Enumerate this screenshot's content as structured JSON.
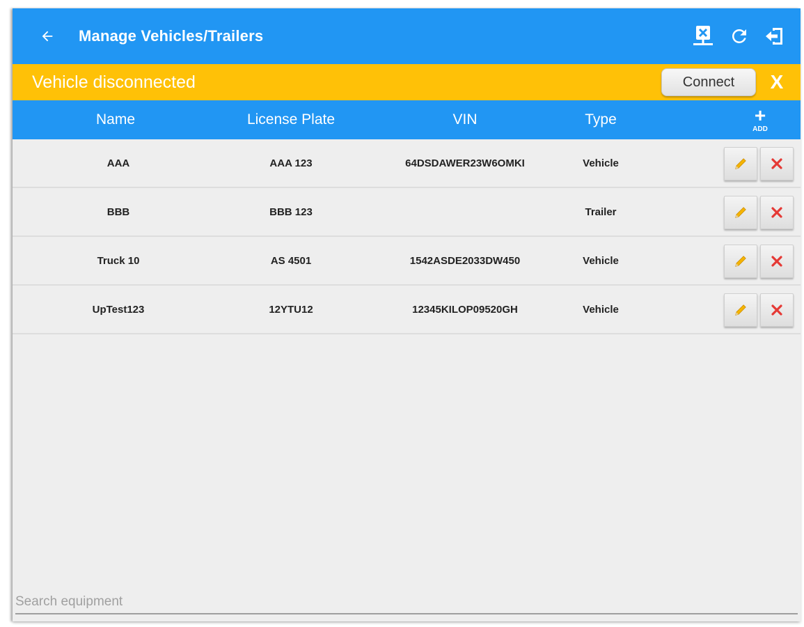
{
  "colors": {
    "primary": "#2196f3",
    "banner": "#ffc107",
    "delete": "#e53935",
    "edit": "#f5b400"
  },
  "appbar": {
    "title": "Manage Vehicles/Trailers",
    "back_icon": "arrow-left-icon",
    "actions": [
      "network-disconnected-icon",
      "refresh-icon",
      "logout-icon"
    ]
  },
  "banner": {
    "message": "Vehicle disconnected",
    "connect_label": "Connect",
    "close_label": "X"
  },
  "table": {
    "columns": [
      "Name",
      "License Plate",
      "VIN",
      "Type"
    ],
    "add_label": "ADD",
    "add_symbol": "+",
    "rows": [
      {
        "name": "AAA",
        "plate": "AAA 123",
        "vin": "64DSDAWER23W6OMKI",
        "type": "Vehicle"
      },
      {
        "name": "BBB",
        "plate": "BBB 123",
        "vin": "",
        "type": "Trailer"
      },
      {
        "name": "Truck 10",
        "plate": "AS 4501",
        "vin": "1542ASDE2033DW450",
        "type": "Vehicle"
      },
      {
        "name": "UpTest123",
        "plate": "12YTU12",
        "vin": "12345KILOP09520GH",
        "type": "Vehicle"
      }
    ]
  },
  "search": {
    "placeholder": "Search equipment",
    "value": ""
  }
}
